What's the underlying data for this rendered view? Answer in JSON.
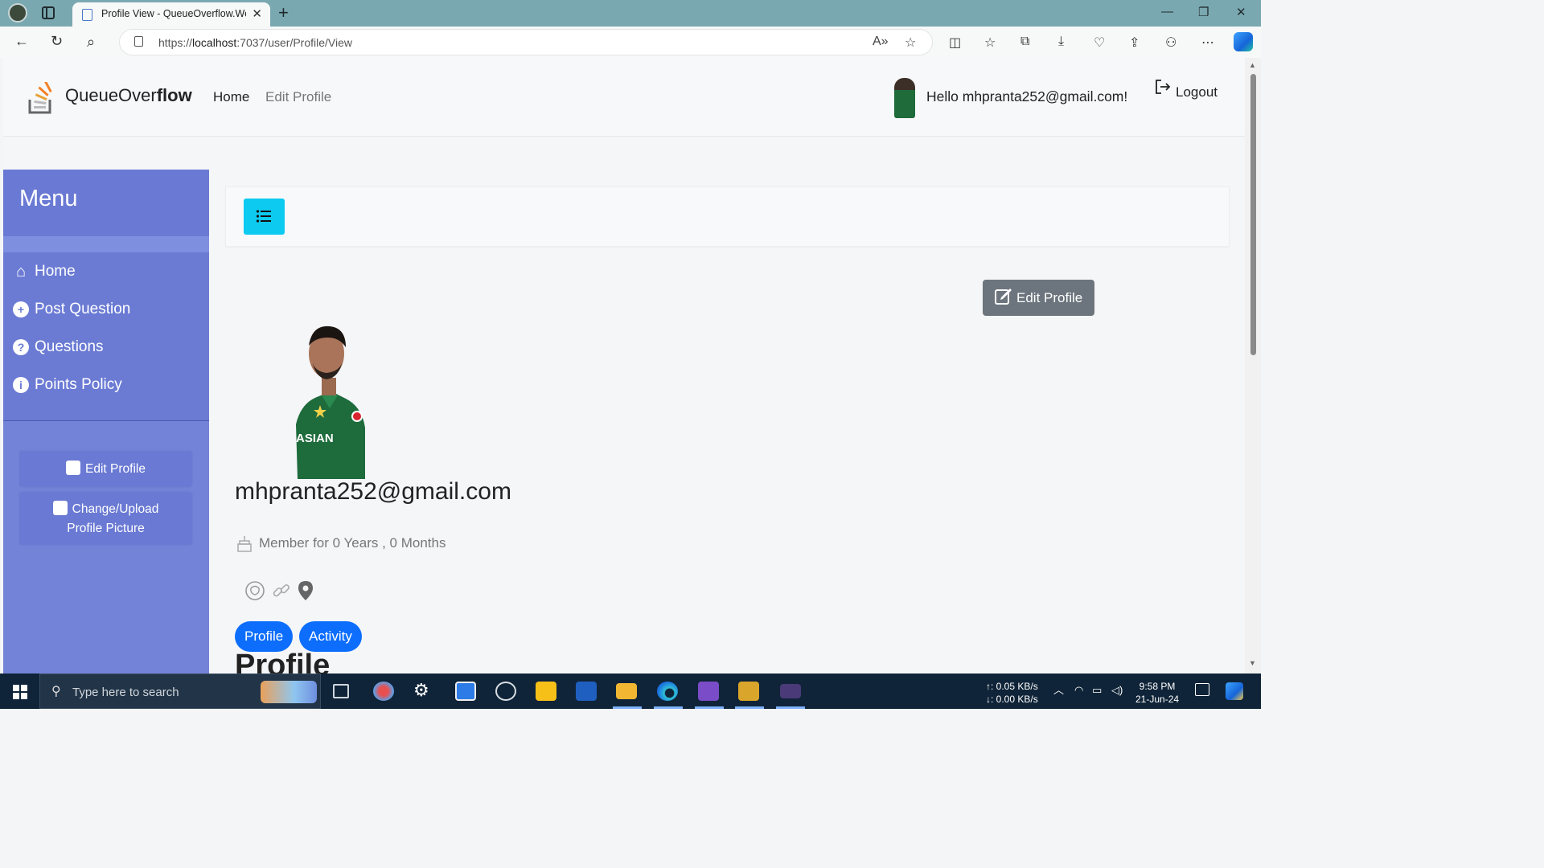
{
  "browser": {
    "tab_title": "Profile View - QueueOverflow.Web",
    "new_tab": "+",
    "url_prefix": "https://",
    "url_host": "localhost",
    "url_rest": ":7037/user/Profile/View"
  },
  "header": {
    "brand_light": "QueueOver",
    "brand_bold": "flow",
    "nav": [
      {
        "label": "Home"
      },
      {
        "label": "Edit Profile"
      }
    ],
    "greeting": "Hello mhpranta252@gmail.com!",
    "logout": "Logout"
  },
  "sidebar": {
    "title": "Menu",
    "items": [
      {
        "label": "Home",
        "icon": "home-icon"
      },
      {
        "label": "Post Question",
        "icon": "plus-circle-icon"
      },
      {
        "label": "Questions",
        "icon": "question-circle-icon"
      },
      {
        "label": "Points Policy",
        "icon": "info-circle-icon"
      }
    ],
    "edit_profile": "Edit Profile",
    "change_pic_line1": "Change/Upload",
    "change_pic_line2": "Profile Picture"
  },
  "main": {
    "edit_button": "Edit Profile",
    "email": "mhpranta252@gmail.com",
    "member_since": "Member for 0 Years , 0 Months",
    "tabs": [
      {
        "label": "Profile"
      },
      {
        "label": "Activity"
      }
    ],
    "section_title": "Profile"
  },
  "taskbar": {
    "search_placeholder": "Type here to search",
    "net_up": "↑: 0.05 KB/s",
    "net_down": "↓: 0.00 KB/s",
    "time": "9:58 PM",
    "date": "21-Jun-24"
  },
  "colors": {
    "sidebar": "#7383d7",
    "info_button": "#0dcaf0",
    "primary_pill": "#0d6efd",
    "secondary_button": "#6c757d"
  }
}
